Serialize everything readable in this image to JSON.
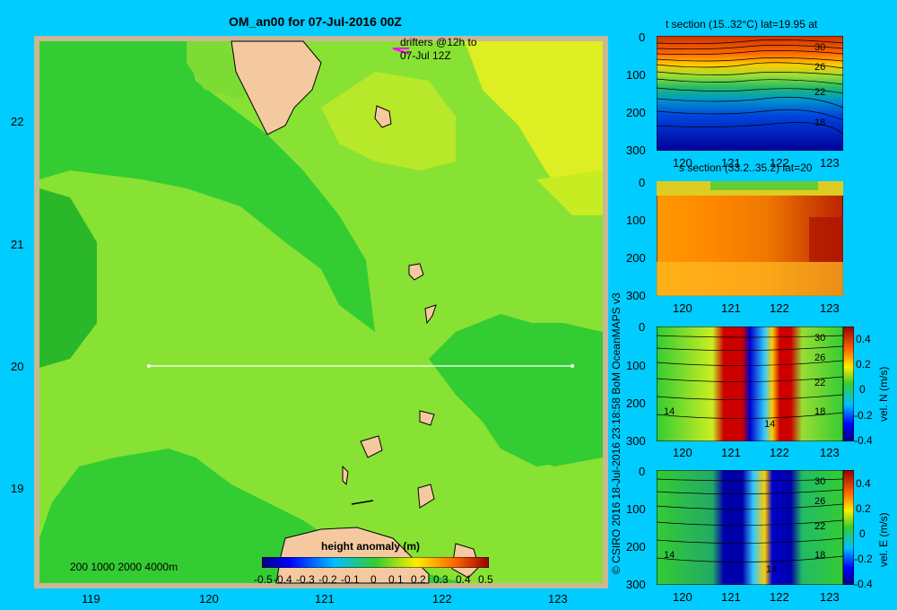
{
  "map": {
    "title": "OM_an00 for 07-Jul-2016 00Z",
    "drifters_line1": "drifters @12h to",
    "drifters_line2": "07-Jul 12Z",
    "x_ticks": [
      "119",
      "120",
      "121",
      "122",
      "123"
    ],
    "y_ticks": [
      "22",
      "21",
      "20",
      "19"
    ],
    "depth_legend": "200  1000  2000  4000m",
    "colorbar_title": "height anomaly (m)",
    "colorbar_ticks": [
      "-0.5",
      "-0.4",
      "-0.3",
      "-0.2",
      "-0.1",
      "0",
      "0.1",
      "0.2",
      "0.3",
      "0.4",
      "0.5"
    ],
    "section_line_lat": 20,
    "section_line_lon": [
      119.5,
      123.2
    ],
    "colors": {
      "land": "#f5c9a0",
      "frame": "#c8b896",
      "ocean_main": "#33cc33",
      "ocean_light": "#99ee33",
      "ocean_yellow": "#ddee22"
    }
  },
  "sections": [
    {
      "title": "t section (15..32°C) lat=19.95 at",
      "y_ticks": [
        "0",
        "100",
        "200",
        "300"
      ],
      "x_ticks": [
        "120",
        "121",
        "122",
        "123"
      ],
      "contour_labels": [
        "30",
        "26",
        "22",
        "18"
      ]
    },
    {
      "title": "s section (33.2..35.2) lat=20",
      "y_ticks": [
        "0",
        "100",
        "200",
        "300"
      ],
      "x_ticks": [
        "120",
        "121",
        "122",
        "123"
      ]
    },
    {
      "title": "",
      "y_ticks": [
        "0",
        "100",
        "200",
        "300"
      ],
      "x_ticks": [
        "120",
        "121",
        "122",
        "123"
      ],
      "contour_labels": [
        "30",
        "26",
        "22",
        "18",
        "14",
        "14"
      ],
      "cbar_label": "vel. N (m/s)",
      "cbar_ticks": [
        "0.4",
        "0.2",
        "0",
        "-0.2",
        "-0.4"
      ]
    },
    {
      "title": "",
      "y_ticks": [
        "0",
        "100",
        "200",
        "300"
      ],
      "x_ticks": [
        "120",
        "121",
        "122",
        "123"
      ],
      "contour_labels": [
        "30",
        "26",
        "22",
        "18",
        "14",
        "14"
      ],
      "cbar_label": "vel. E (m/s)",
      "cbar_ticks": [
        "0.4",
        "0.2",
        "0",
        "-0.2",
        "-0.4"
      ]
    }
  ],
  "credit": "© CSIRO 2016   18-Jul-2016 23:18:58 BoM OceanMAPS v3"
}
